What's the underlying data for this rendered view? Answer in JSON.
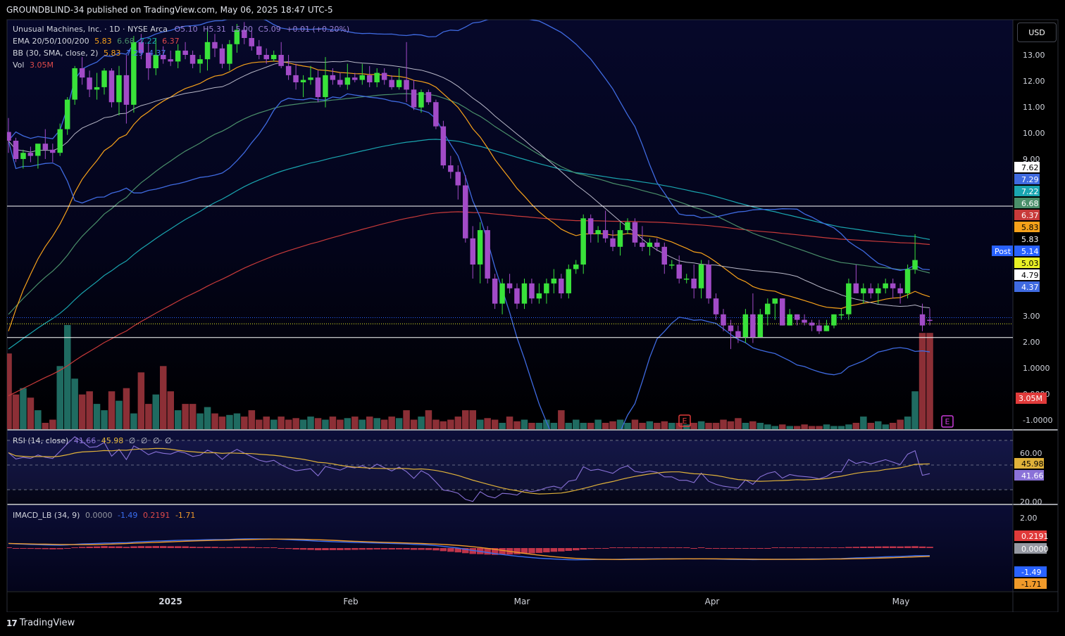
{
  "header": {
    "publish_line": "GROUNDBLIND-34 published on TradingView.com, May 06, 2025 18:47 UTC-5"
  },
  "footer": {
    "logo_text": "TradingView",
    "logo_mark": "17"
  },
  "currency_button": "USD",
  "legend": {
    "main_title": "Unusual Machines, Inc. · 1D · NYSE Arca",
    "ohlc": {
      "o_label": "O",
      "o": "5.10",
      "h_label": "H",
      "h": "5.31",
      "l_label": "L",
      "l": "5.00",
      "c_label": "C",
      "c": "5.09",
      "chg": "+0.01 (+0.20%)"
    },
    "ema_label": "EMA 20/50/100/200",
    "ema_values": [
      "5.83",
      "6.68",
      "7.22",
      "6.37"
    ],
    "bb_label": "BB (30, SMA, close, 2)",
    "bb_values": [
      "5.83",
      "7.29",
      "4.37"
    ],
    "vol_label": "Vol",
    "vol_value": "3.05M",
    "rsi_label": "RSI (14, close)",
    "rsi_values": [
      "41.66",
      "45.98",
      "∅",
      "∅",
      "∅",
      "∅"
    ],
    "macd_label": "IMACD_LB (34, 9)",
    "macd_values": [
      "0.0000",
      "-1.49",
      "0.2191",
      "-1.71"
    ]
  },
  "colors": {
    "bg_top": "#06082a",
    "bg_bottom": "#000000",
    "candle_up": "#39e23a",
    "candle_down": "#a24bc7",
    "vol_up": "#1f6b61",
    "vol_down": "#8c2f36",
    "ema20": "#f6a11a",
    "ema50": "#4a8f6a",
    "ema100": "#1aa6b0",
    "ema200": "#c83a3a",
    "bb_basis": "#b8b8c8",
    "bb_band": "#3f6ae0",
    "rsi_line": "#8a72d8",
    "rsi_ma": "#e0b23a",
    "macd_line": "#3a6ef0",
    "macd_signal": "#f09a2a",
    "macd_hist": "#c0344a"
  },
  "price_axis": {
    "ticks": [
      "13.00",
      "12.00",
      "11.00",
      "10.00",
      "9.00",
      "3.00",
      "2.00",
      "1.0000",
      "0.0000",
      "-1.0000"
    ],
    "labels": [
      {
        "text": "7.62",
        "bg": "#ffffff",
        "fg": "#000000"
      },
      {
        "text": "7.29",
        "bg": "#3f6ae0",
        "fg": "#ffffff"
      },
      {
        "text": "7.22",
        "bg": "#1aa6b0",
        "fg": "#ffffff"
      },
      {
        "text": "6.68",
        "bg": "#4a8f6a",
        "fg": "#ffffff"
      },
      {
        "text": "6.37",
        "bg": "#c83a3a",
        "fg": "#ffffff"
      },
      {
        "text": "5.83",
        "bg": "#f6a11a",
        "fg": "#000000"
      },
      {
        "text": "5.83",
        "bg": "#000000",
        "fg": "#ffffff"
      },
      {
        "text": "5.14",
        "bg": "#2962ff",
        "fg": "#ffffff"
      },
      {
        "text": "5.03",
        "bg": "#e8f025",
        "fg": "#000000"
      },
      {
        "text": "4.79",
        "bg": "#ffffff",
        "fg": "#000000"
      },
      {
        "text": "4.37",
        "bg": "#3f6ae0",
        "fg": "#ffffff"
      }
    ],
    "post_label": "Post",
    "vol_label": "3.05M"
  },
  "rsi_axis": {
    "ticks": [
      "60.00",
      "20.00"
    ],
    "labels": [
      {
        "text": "45.98",
        "bg": "#e0b23a",
        "fg": "#000000"
      },
      {
        "text": "41.66",
        "bg": "#8a72d8",
        "fg": "#ffffff"
      }
    ]
  },
  "macd_axis": {
    "ticks": [
      "2.00"
    ],
    "labels": [
      {
        "text": "0.2191",
        "bg": "#e03a3a",
        "fg": "#ffffff"
      },
      {
        "text": "0.0000",
        "bg": "#9598a1",
        "fg": "#ffffff"
      },
      {
        "text": "-1.49",
        "bg": "#2962ff",
        "fg": "#ffffff"
      },
      {
        "text": "-1.71",
        "bg": "#f09a2a",
        "fg": "#000000"
      }
    ]
  },
  "time_axis": [
    "2025",
    "Feb",
    "Mar",
    "Apr",
    "May"
  ],
  "earnings_marker": "E",
  "chart_data": {
    "type": "candlestick",
    "title": "Unusual Machines, Inc. · 1D · NYSE Arca",
    "price_scale": {
      "ticks": [
        13,
        12,
        11,
        10,
        9
      ],
      "log": true
    },
    "horizontal_lines": [
      7.62,
      4.79
    ],
    "candles": [
      [
        9.9,
        10.4,
        9.2,
        9.6
      ],
      [
        9.6,
        9.7,
        8.9,
        9.0
      ],
      [
        9.0,
        9.3,
        8.7,
        9.2
      ],
      [
        9.2,
        9.4,
        8.9,
        9.1
      ],
      [
        9.1,
        9.4,
        8.7,
        9.5
      ],
      [
        9.5,
        10.0,
        9.0,
        9.3
      ],
      [
        9.3,
        9.5,
        8.9,
        9.2
      ],
      [
        9.2,
        10.2,
        9.1,
        10.0
      ],
      [
        10.0,
        11.2,
        9.8,
        11.1
      ],
      [
        11.1,
        12.5,
        10.9,
        12.4
      ],
      [
        12.4,
        12.9,
        11.7,
        12.0
      ],
      [
        12.0,
        12.3,
        11.2,
        11.5
      ],
      [
        11.5,
        12.2,
        11.1,
        11.6
      ],
      [
        11.6,
        12.4,
        11.3,
        12.3
      ],
      [
        12.3,
        12.4,
        10.8,
        11.0
      ],
      [
        11.0,
        12.5,
        10.5,
        12.1
      ],
      [
        12.1,
        13.0,
        10.2,
        10.9
      ],
      [
        10.9,
        13.9,
        10.6,
        13.6
      ],
      [
        13.6,
        14.0,
        12.8,
        13.1
      ],
      [
        13.1,
        13.6,
        11.9,
        12.4
      ],
      [
        12.4,
        13.8,
        12.1,
        13.0
      ],
      [
        13.0,
        13.4,
        12.6,
        12.8
      ],
      [
        12.8,
        13.2,
        12.5,
        12.7
      ],
      [
        12.7,
        13.5,
        12.4,
        13.2
      ],
      [
        13.2,
        13.6,
        12.8,
        13.0
      ],
      [
        13.0,
        13.2,
        12.4,
        12.6
      ],
      [
        12.6,
        13.0,
        12.2,
        12.8
      ],
      [
        12.8,
        14.3,
        12.3,
        13.6
      ],
      [
        13.6,
        14.0,
        12.9,
        13.3
      ],
      [
        13.3,
        13.5,
        12.4,
        12.6
      ],
      [
        12.6,
        13.7,
        12.3,
        13.5
      ],
      [
        13.5,
        14.5,
        13.1,
        14.2
      ],
      [
        14.2,
        14.6,
        13.5,
        13.8
      ],
      [
        13.8,
        14.2,
        13.2,
        13.4
      ],
      [
        13.4,
        13.7,
        12.8,
        13.0
      ],
      [
        13.0,
        13.3,
        12.6,
        12.8
      ],
      [
        12.8,
        13.2,
        12.7,
        13.0
      ],
      [
        13.0,
        13.6,
        12.4,
        12.5
      ],
      [
        12.5,
        13.0,
        11.9,
        12.1
      ],
      [
        12.1,
        12.6,
        11.5,
        11.8
      ],
      [
        11.8,
        12.1,
        11.2,
        11.9
      ],
      [
        11.9,
        12.5,
        11.7,
        12.0
      ],
      [
        12.0,
        12.3,
        11.0,
        11.2
      ],
      [
        11.2,
        12.9,
        10.8,
        12.1
      ],
      [
        12.1,
        12.4,
        11.7,
        11.9
      ],
      [
        11.9,
        12.2,
        11.6,
        11.7
      ],
      [
        11.7,
        12.6,
        11.5,
        12.0
      ],
      [
        12.0,
        12.2,
        11.8,
        11.9
      ],
      [
        11.9,
        12.6,
        11.7,
        12.1
      ],
      [
        12.1,
        12.5,
        11.6,
        11.8
      ],
      [
        11.8,
        12.4,
        11.6,
        12.2
      ],
      [
        12.2,
        12.4,
        11.7,
        11.9
      ],
      [
        11.9,
        12.1,
        11.5,
        11.6
      ],
      [
        11.6,
        12.4,
        11.5,
        11.9
      ],
      [
        11.9,
        13.6,
        11.0,
        11.5
      ],
      [
        11.5,
        11.9,
        10.7,
        10.8
      ],
      [
        10.8,
        11.5,
        10.6,
        11.4
      ],
      [
        11.4,
        11.5,
        10.9,
        11.0
      ],
      [
        11.0,
        11.1,
        10.0,
        10.1
      ],
      [
        10.1,
        10.3,
        8.7,
        8.8
      ],
      [
        8.8,
        9.1,
        8.4,
        8.6
      ],
      [
        8.6,
        8.8,
        7.8,
        8.2
      ],
      [
        8.2,
        8.5,
        6.7,
        6.8
      ],
      [
        6.8,
        7.1,
        5.9,
        6.2
      ],
      [
        6.2,
        7.2,
        5.8,
        7.0
      ],
      [
        7.0,
        7.1,
        5.8,
        5.9
      ],
      [
        5.9,
        6.0,
        5.3,
        5.4
      ],
      [
        5.4,
        5.9,
        5.2,
        5.8
      ],
      [
        5.8,
        6.0,
        5.6,
        5.7
      ],
      [
        5.7,
        5.8,
        5.3,
        5.4
      ],
      [
        5.4,
        5.9,
        5.3,
        5.8
      ],
      [
        5.8,
        5.9,
        5.4,
        5.5
      ],
      [
        5.5,
        5.8,
        5.4,
        5.6
      ],
      [
        5.6,
        5.9,
        5.4,
        5.8
      ],
      [
        5.8,
        6.1,
        5.6,
        5.9
      ],
      [
        5.9,
        6.0,
        5.5,
        5.6
      ],
      [
        5.6,
        6.2,
        5.5,
        6.1
      ],
      [
        6.1,
        6.3,
        6.0,
        6.2
      ],
      [
        6.2,
        7.4,
        6.0,
        7.3
      ],
      [
        7.3,
        7.4,
        6.7,
        6.9
      ],
      [
        6.9,
        7.1,
        6.7,
        7.0
      ],
      [
        7.0,
        7.5,
        6.7,
        6.8
      ],
      [
        6.8,
        7.0,
        6.5,
        6.6
      ],
      [
        6.6,
        7.2,
        6.4,
        7.0
      ],
      [
        7.0,
        7.3,
        6.9,
        7.2
      ],
      [
        7.2,
        7.3,
        6.6,
        6.7
      ],
      [
        6.7,
        7.1,
        6.5,
        6.6
      ],
      [
        6.6,
        6.8,
        6.4,
        6.7
      ],
      [
        6.7,
        6.8,
        6.5,
        6.6
      ],
      [
        6.6,
        6.7,
        6.0,
        6.2
      ],
      [
        6.2,
        6.3,
        6.1,
        6.2
      ],
      [
        6.2,
        6.4,
        5.8,
        5.9
      ],
      [
        5.9,
        6.0,
        5.8,
        5.9
      ],
      [
        5.9,
        6.2,
        5.5,
        5.7
      ],
      [
        5.7,
        6.3,
        5.5,
        6.2
      ],
      [
        6.2,
        6.3,
        5.4,
        5.5
      ],
      [
        5.5,
        5.6,
        5.1,
        5.2
      ],
      [
        5.2,
        5.3,
        4.9,
        5.0
      ],
      [
        5.0,
        5.1,
        4.6,
        4.9
      ],
      [
        4.9,
        5.0,
        4.7,
        4.8
      ],
      [
        4.8,
        5.3,
        4.7,
        5.2
      ],
      [
        5.2,
        5.6,
        4.7,
        4.8
      ],
      [
        4.8,
        5.3,
        4.8,
        5.2
      ],
      [
        5.2,
        5.5,
        5.0,
        5.4
      ],
      [
        5.4,
        5.5,
        5.1,
        5.5
      ],
      [
        5.5,
        5.5,
        5.0,
        5.0
      ],
      [
        5.0,
        5.3,
        5.0,
        5.2
      ],
      [
        5.2,
        5.2,
        5.0,
        5.1
      ],
      [
        5.1,
        5.2,
        5.0,
        5.05
      ],
      [
        5.05,
        5.1,
        4.9,
        5.0
      ],
      [
        5.0,
        5.1,
        4.85,
        4.9
      ],
      [
        4.9,
        5.1,
        4.9,
        5.0
      ],
      [
        5.0,
        5.2,
        4.95,
        5.2
      ],
      [
        5.2,
        5.3,
        5.1,
        5.2
      ],
      [
        5.2,
        5.9,
        5.1,
        5.8
      ],
      [
        5.8,
        6.2,
        5.6,
        5.6
      ],
      [
        5.6,
        5.8,
        5.4,
        5.7
      ],
      [
        5.7,
        5.8,
        5.5,
        5.6
      ],
      [
        5.6,
        5.8,
        5.4,
        5.7
      ],
      [
        5.7,
        5.9,
        5.6,
        5.8
      ],
      [
        5.8,
        5.9,
        5.5,
        5.7
      ],
      [
        5.7,
        5.8,
        5.4,
        5.6
      ],
      [
        5.6,
        6.2,
        5.5,
        6.1
      ],
      [
        6.1,
        6.9,
        6.0,
        6.3
      ],
      [
        5.2,
        5.4,
        4.9,
        5.0
      ],
      [
        5.1,
        5.31,
        5.0,
        5.09
      ]
    ],
    "volume_millions": [
      2.4,
      1.1,
      1.3,
      1.0,
      0.6,
      0.2,
      0.3,
      2.0,
      3.3,
      1.6,
      1.1,
      1.2,
      0.8,
      0.6,
      1.2,
      0.9,
      1.3,
      0.5,
      1.8,
      0.8,
      1.1,
      2.0,
      1.2,
      0.6,
      0.8,
      0.8,
      0.5,
      0.7,
      0.5,
      0.4,
      0.45,
      0.5,
      0.4,
      0.6,
      0.3,
      0.4,
      0.3,
      0.4,
      0.3,
      0.35,
      0.3,
      0.4,
      0.35,
      0.3,
      0.4,
      0.3,
      0.35,
      0.4,
      0.3,
      0.4,
      0.35,
      0.3,
      0.4,
      0.35,
      0.6,
      0.3,
      0.4,
      0.6,
      0.3,
      0.25,
      0.3,
      0.4,
      0.6,
      0.6,
      0.3,
      0.35,
      0.3,
      0.2,
      0.4,
      0.25,
      0.3,
      0.2,
      0.2,
      0.3,
      0.2,
      0.6,
      0.2,
      0.3,
      0.2,
      0.2,
      0.3,
      0.2,
      0.25,
      0.3,
      0.2,
      0.3,
      0.2,
      0.25,
      0.2,
      0.25,
      0.2,
      0.2,
      0.15,
      0.2,
      0.25,
      0.2,
      0.2,
      0.3,
      0.25,
      0.35,
      0.2,
      0.25,
      0.2,
      0.15,
      0.1,
      0.15,
      0.1,
      0.1,
      0.15,
      0.1,
      0.1,
      0.15,
      0.1,
      0.1,
      0.15,
      0.2,
      0.4,
      0.2,
      0.25,
      0.15,
      0.2,
      0.3,
      0.4,
      1.2,
      3.05,
      3.05
    ],
    "series": [
      {
        "name": "EMA 20",
        "last": 5.83
      },
      {
        "name": "EMA 50",
        "last": 6.68
      },
      {
        "name": "EMA 100",
        "last": 7.22
      },
      {
        "name": "EMA 200",
        "last": 6.37
      },
      {
        "name": "BB basis",
        "last": 5.83
      },
      {
        "name": "BB upper",
        "last": 7.29
      },
      {
        "name": "BB lower",
        "last": 4.37
      },
      {
        "name": "RSI",
        "last": 41.66
      },
      {
        "name": "RSI MA",
        "last": 45.98
      },
      {
        "name": "IMACD",
        "last": -1.49
      },
      {
        "name": "Signal",
        "last": -1.71
      },
      {
        "name": "Histogram",
        "last": 0.2191
      }
    ]
  }
}
